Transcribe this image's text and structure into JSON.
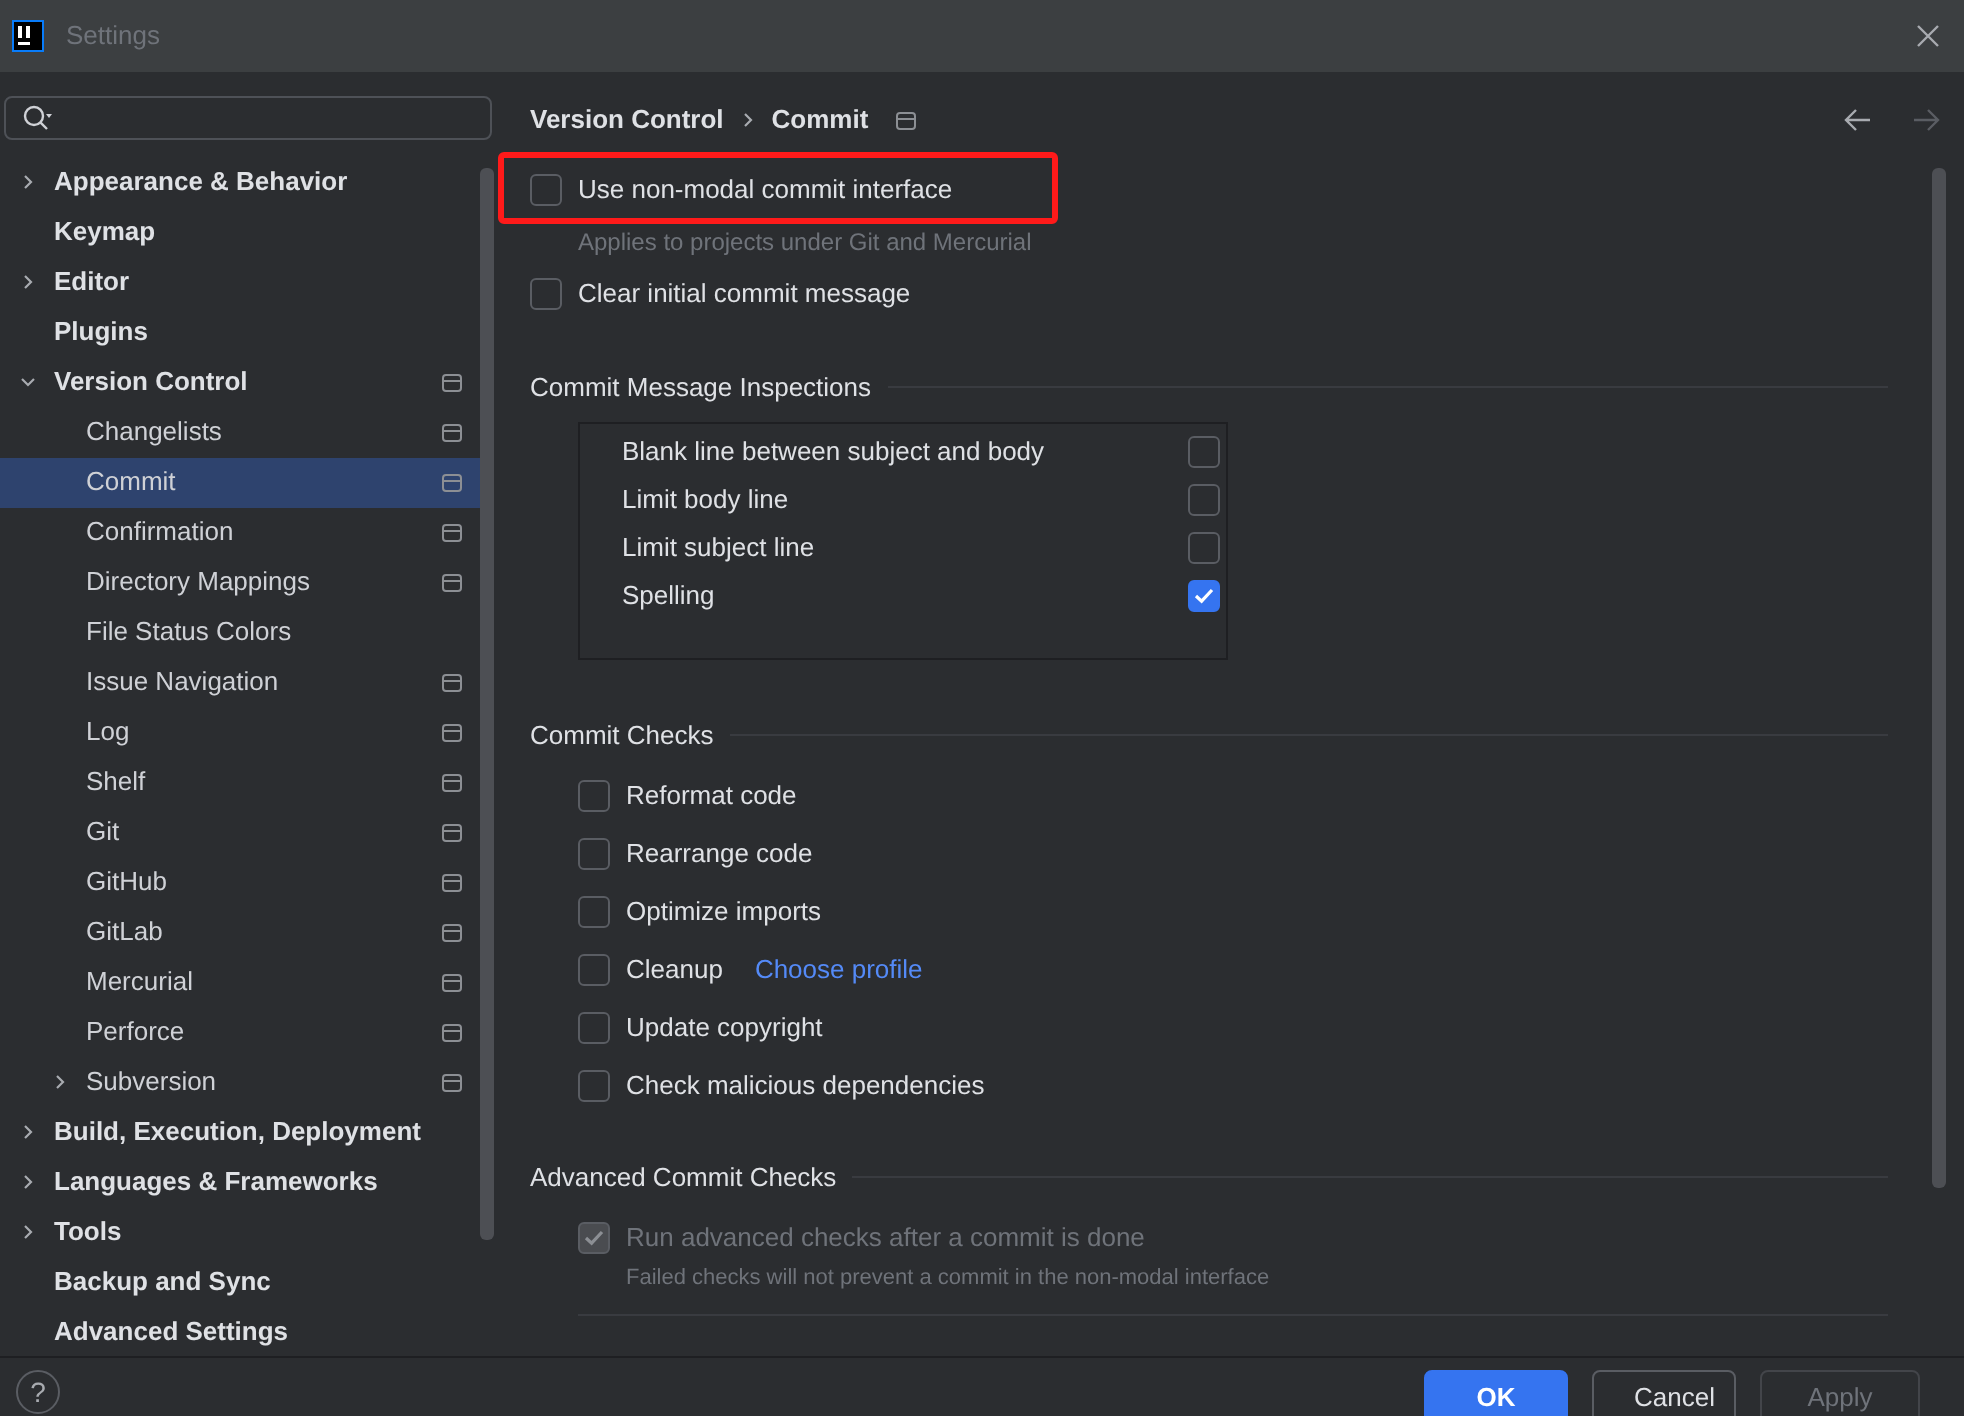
{
  "window": {
    "title": "Settings"
  },
  "help": {
    "label": "?"
  },
  "sidebar": {
    "items": [
      {
        "label": "Appearance & Behavior",
        "expandable": true,
        "expanded": false,
        "selected": false,
        "project_icon": false
      },
      {
        "label": "Keymap",
        "expandable": false,
        "expanded": false,
        "selected": false,
        "project_icon": false
      },
      {
        "label": "Editor",
        "expandable": true,
        "expanded": false,
        "selected": false,
        "project_icon": false
      },
      {
        "label": "Plugins",
        "expandable": false,
        "expanded": false,
        "selected": false,
        "project_icon": false
      },
      {
        "label": "Version Control",
        "expandable": true,
        "expanded": true,
        "selected": false,
        "project_icon": true,
        "children": [
          {
            "label": "Changelists",
            "expandable": false,
            "expanded": false,
            "selected": false,
            "project_icon": true
          },
          {
            "label": "Commit",
            "expandable": false,
            "expanded": false,
            "selected": true,
            "project_icon": true
          },
          {
            "label": "Confirmation",
            "expandable": false,
            "expanded": false,
            "selected": false,
            "project_icon": true
          },
          {
            "label": "Directory Mappings",
            "expandable": false,
            "expanded": false,
            "selected": false,
            "project_icon": true
          },
          {
            "label": "File Status Colors",
            "expandable": false,
            "expanded": false,
            "selected": false,
            "project_icon": false
          },
          {
            "label": "Issue Navigation",
            "expandable": false,
            "expanded": false,
            "selected": false,
            "project_icon": true
          },
          {
            "label": "Log",
            "expandable": false,
            "expanded": false,
            "selected": false,
            "project_icon": true
          },
          {
            "label": "Shelf",
            "expandable": false,
            "expanded": false,
            "selected": false,
            "project_icon": true
          },
          {
            "label": "Git",
            "expandable": false,
            "expanded": false,
            "selected": false,
            "project_icon": true
          },
          {
            "label": "GitHub",
            "expandable": false,
            "expanded": false,
            "selected": false,
            "project_icon": true
          },
          {
            "label": "GitLab",
            "expandable": false,
            "expanded": false,
            "selected": false,
            "project_icon": true
          },
          {
            "label": "Mercurial",
            "expandable": false,
            "expanded": false,
            "selected": false,
            "project_icon": true
          },
          {
            "label": "Perforce",
            "expandable": false,
            "expanded": false,
            "selected": false,
            "project_icon": true
          },
          {
            "label": "Subversion",
            "expandable": true,
            "expanded": false,
            "selected": false,
            "project_icon": true
          }
        ]
      },
      {
        "label": "Build, Execution, Deployment",
        "expandable": true,
        "expanded": false,
        "selected": false,
        "project_icon": false
      },
      {
        "label": "Languages & Frameworks",
        "expandable": true,
        "expanded": false,
        "selected": false,
        "project_icon": false
      },
      {
        "label": "Tools",
        "expandable": true,
        "expanded": false,
        "selected": false,
        "project_icon": false
      },
      {
        "label": "Backup and Sync",
        "expandable": false,
        "expanded": false,
        "selected": false,
        "project_icon": false
      },
      {
        "label": "Advanced Settings",
        "expandable": false,
        "expanded": false,
        "selected": false,
        "project_icon": false
      }
    ]
  },
  "breadcrumb": [
    "Version Control",
    "Commit"
  ],
  "options": [
    {
      "label": "Use non-modal commit interface",
      "checked": false,
      "highlighted": true,
      "hint": "Applies to projects under Git and Mercurial"
    },
    {
      "label": "Clear initial commit message",
      "checked": false,
      "highlighted": false
    }
  ],
  "inspections": {
    "title": "Commit Message Inspections",
    "rows": [
      {
        "label": "Blank line between subject and body",
        "checked": false
      },
      {
        "label": "Limit body line",
        "checked": false
      },
      {
        "label": "Limit subject line",
        "checked": false
      },
      {
        "label": "Spelling",
        "checked": true
      }
    ]
  },
  "commit_checks": {
    "title": "Commit Checks",
    "items": [
      {
        "label": "Reformat code",
        "checked": false
      },
      {
        "label": "Rearrange code",
        "checked": false
      },
      {
        "label": "Optimize imports",
        "checked": false
      },
      {
        "label": "Cleanup",
        "checked": false,
        "link": "Choose profile"
      },
      {
        "label": "Update copyright",
        "checked": false
      },
      {
        "label": "Check malicious dependencies",
        "checked": false
      }
    ]
  },
  "advanced_checks": {
    "title": "Advanced Commit Checks",
    "items": [
      {
        "label": "Run advanced checks after a commit is done",
        "checked": true,
        "disabled": true,
        "hint": "Failed checks will not prevent a commit in the non-modal interface"
      }
    ]
  },
  "buttons": [
    {
      "label": "OK",
      "kind": "primary",
      "disabled": false
    },
    {
      "label": "Cancel",
      "kind": "secondary",
      "disabled": false
    },
    {
      "label": "Apply",
      "kind": "secondary",
      "disabled": true
    }
  ]
}
